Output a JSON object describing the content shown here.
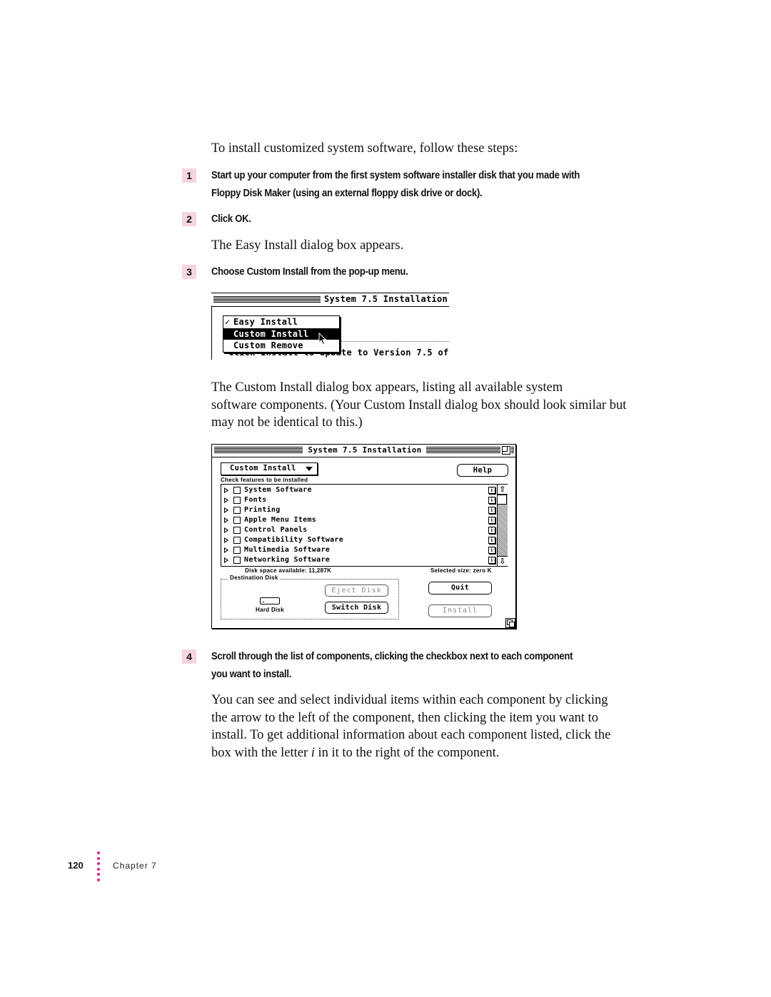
{
  "intro": "To install customized system software, follow these steps:",
  "steps": [
    {
      "number": "1",
      "lines": [
        "Start up your computer from the first system software installer disk that you made with",
        "Floppy Disk Maker (using an external floppy disk drive or dock)."
      ]
    },
    {
      "number": "2",
      "lines": [
        "Click OK."
      ]
    },
    {
      "number": "3",
      "lines": [
        "Choose Custom Install from the pop-up menu."
      ]
    },
    {
      "number": "4",
      "lines": [
        "Scroll through the list of components, clicking the checkbox next to each component",
        "you want to install."
      ]
    }
  ],
  "after_step2": "The Easy Install dialog box appears.",
  "custom_dialog_para": [
    "The Custom Install dialog box appears, listing all available system",
    "software components. (Your Custom Install dialog box should look similar but",
    "may not be identical to this.)"
  ],
  "final_para": {
    "line1": "You can see and select individual items within each component by clicking",
    "line2": "the arrow to the left of the component, then clicking the item you want to",
    "line3": "install. To get additional information about each component listed, click the",
    "line4_pre": "box with the letter ",
    "line4_em": "i",
    "line4_post": " in it to the right of the component."
  },
  "popup_excerpt": {
    "window_title": "System 7.5 Installation",
    "menu_items": [
      {
        "label": "Easy Install",
        "checked": true,
        "highlighted": false
      },
      {
        "label": "Custom Install",
        "checked": false,
        "highlighted": true
      },
      {
        "label": "Custom Remove",
        "checked": false,
        "highlighted": false
      }
    ],
    "check_glyph": "✓",
    "underlying_text": "Click Install to update to Version 7.5 of"
  },
  "dialog": {
    "window_title": "System 7.5 Installation",
    "mode_popup": "Custom Install",
    "help_button": "Help",
    "hint": "Check features to be installed",
    "components": [
      {
        "label": "System Software",
        "checked": false
      },
      {
        "label": "Fonts",
        "checked": false
      },
      {
        "label": "Printing",
        "checked": false
      },
      {
        "label": "Apple Menu Items",
        "checked": false
      },
      {
        "label": "Control Panels",
        "checked": false
      },
      {
        "label": "Compatibility Software",
        "checked": false
      },
      {
        "label": "Multimedia Software",
        "checked": false
      },
      {
        "label": "Networking Software",
        "checked": false
      }
    ],
    "info_glyph": "i",
    "scroll_up_glyph": "⇧",
    "scroll_down_glyph": "⇩",
    "disk_space": "Disk space available: 11,287K",
    "selected_size": "Selected size: zero K",
    "destination_label": "Destination Disk",
    "disk_name": "Hard Disk",
    "eject_button": "Eject Disk",
    "switch_button": "Switch Disk",
    "quit_button": "Quit",
    "install_button": "Install"
  },
  "footer": {
    "page_number": "120",
    "chapter": "Chapter 7"
  },
  "colors": {
    "step_badge": "#f7d4e3",
    "footer_dots": "#e0218a"
  }
}
